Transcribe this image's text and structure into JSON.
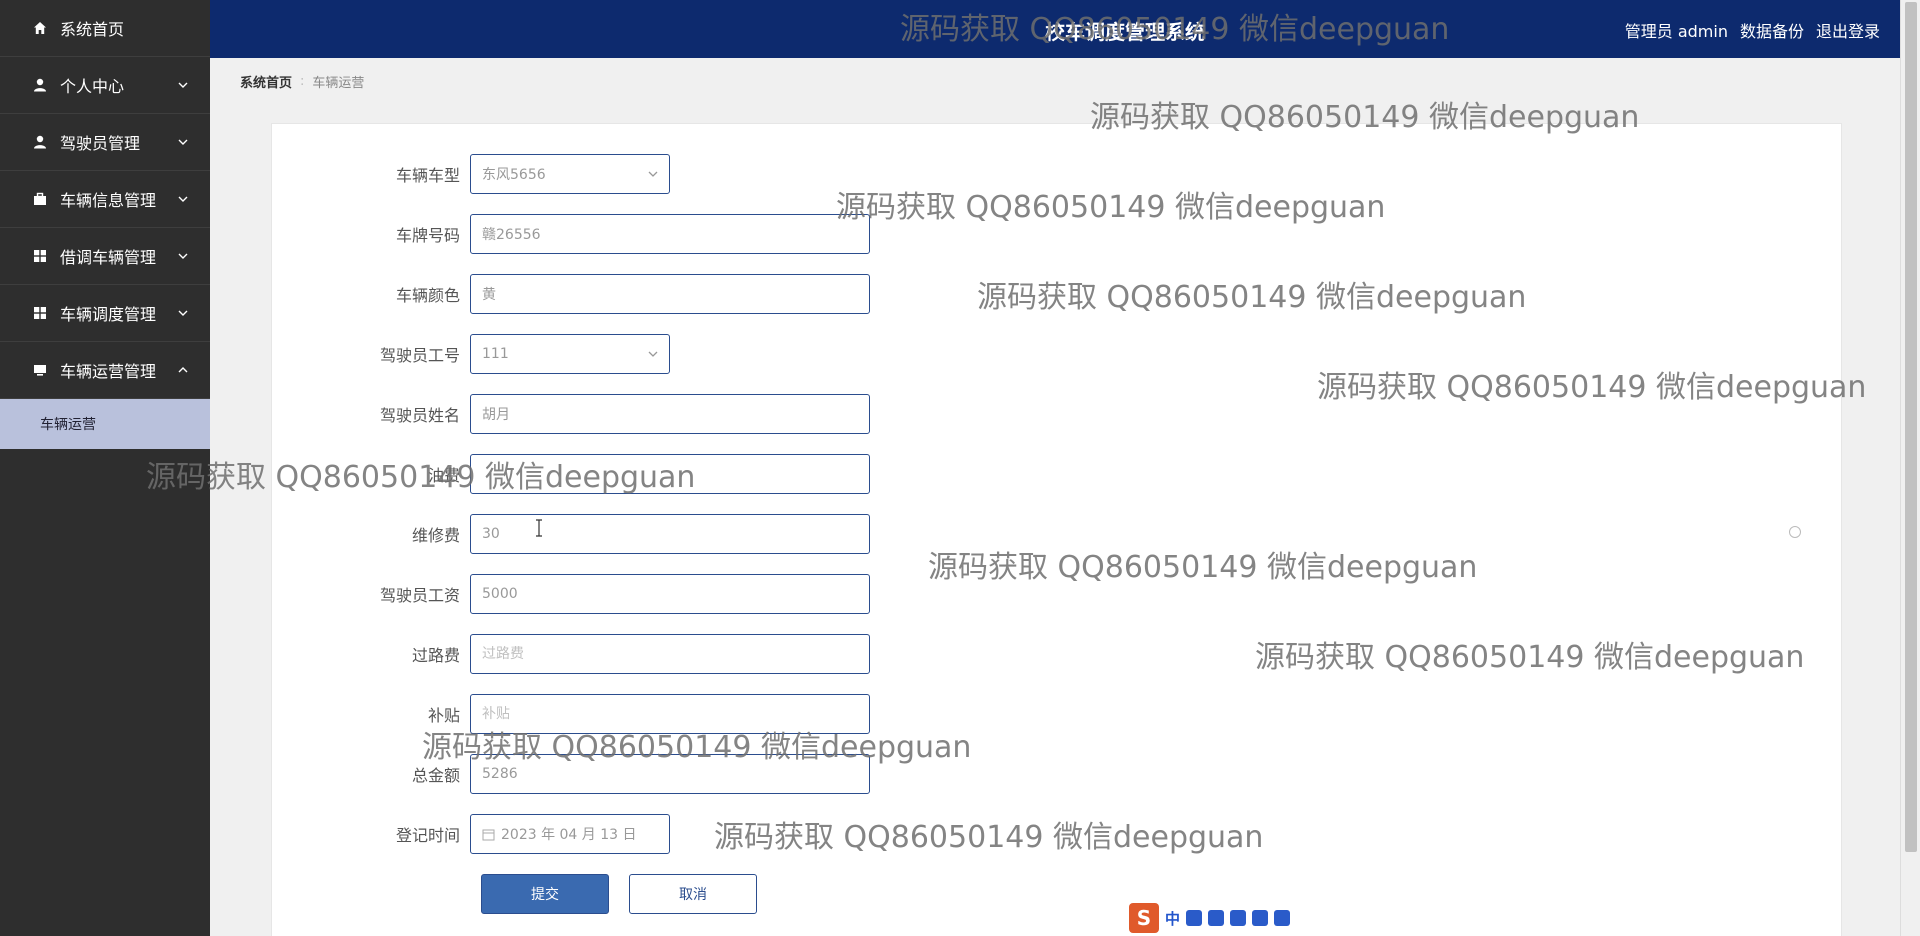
{
  "sidebar": {
    "items": [
      {
        "label": "系统首页",
        "icon": "home-icon",
        "has_chevron": false
      },
      {
        "label": "个人中心",
        "icon": "person-icon",
        "has_chevron": true
      },
      {
        "label": "驾驶员管理",
        "icon": "person-icon",
        "has_chevron": true
      },
      {
        "label": "车辆信息管理",
        "icon": "briefcase-icon",
        "has_chevron": true
      },
      {
        "label": "借调车辆管理",
        "icon": "grid-icon",
        "has_chevron": true
      },
      {
        "label": "车辆调度管理",
        "icon": "grid-icon",
        "has_chevron": true
      },
      {
        "label": "车辆运营管理",
        "icon": "monitor-icon",
        "has_chevron": true,
        "expanded": true
      }
    ],
    "sub_items": [
      {
        "label": "车辆运营"
      }
    ]
  },
  "header": {
    "title": "校车调度管理系统",
    "user": "管理员 admin",
    "backup": "数据备份",
    "logout": "退出登录"
  },
  "breadcrumb": {
    "home": "系统首页",
    "current": "车辆运营"
  },
  "form": {
    "fields": [
      {
        "label": "车辆车型",
        "value": "东风5656",
        "placeholder": "",
        "kind": "select"
      },
      {
        "label": "车牌号码",
        "value": "赣26556",
        "placeholder": "",
        "kind": "input"
      },
      {
        "label": "车辆颜色",
        "value": "黄",
        "placeholder": "",
        "kind": "input"
      },
      {
        "label": "驾驶员工号",
        "value": "111",
        "placeholder": "",
        "kind": "select"
      },
      {
        "label": "驾驶员姓名",
        "value": "胡月",
        "placeholder": "",
        "kind": "input"
      },
      {
        "label": "油费",
        "value": "",
        "placeholder": "",
        "kind": "input"
      },
      {
        "label": "维修费",
        "value": "30",
        "placeholder": "",
        "kind": "input"
      },
      {
        "label": "驾驶员工资",
        "value": "5000",
        "placeholder": "",
        "kind": "input"
      },
      {
        "label": "过路费",
        "value": "",
        "placeholder": "过路费",
        "kind": "input"
      },
      {
        "label": "补贴",
        "value": "",
        "placeholder": "补贴",
        "kind": "input"
      },
      {
        "label": "总金额",
        "value": "5286",
        "placeholder": "",
        "kind": "input"
      },
      {
        "label": "登记时间",
        "value": "2023 年 04 月 13 日",
        "placeholder": "",
        "kind": "date"
      }
    ],
    "submit_label": "提交",
    "cancel_label": "取消"
  },
  "watermark": {
    "text": "源码获取 QQ86050149 微信deepguan"
  },
  "ime": {
    "logo": "S",
    "mode": "中"
  },
  "colors": {
    "header_bg": "#0d2a6e",
    "sidebar_bg": "#2e2e2e",
    "sub_item_bg": "#b9c1dc",
    "accent": "#3a6ab0",
    "border": "#2b4d8e"
  }
}
